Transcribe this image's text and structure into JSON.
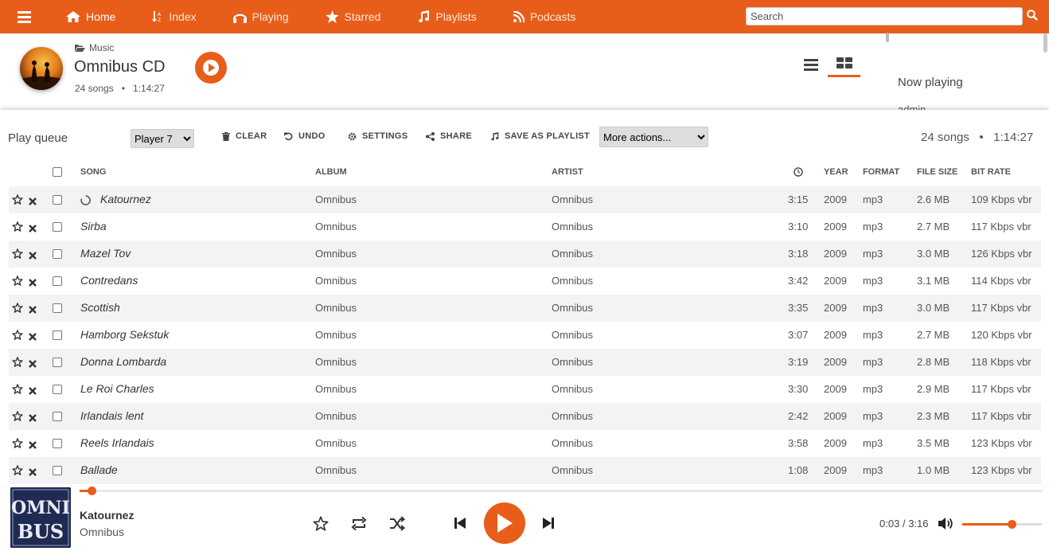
{
  "colors": {
    "accent": "#e85d1a"
  },
  "nav": {
    "items": [
      {
        "label": "Home",
        "icon": "home-icon"
      },
      {
        "label": "Index",
        "icon": "sort-alpha-icon"
      },
      {
        "label": "Playing",
        "icon": "headphones-icon"
      },
      {
        "label": "Starred",
        "icon": "star-icon"
      },
      {
        "label": "Playlists",
        "icon": "music-icon"
      },
      {
        "label": "Podcasts",
        "icon": "rss-icon"
      }
    ],
    "search_placeholder": "Search"
  },
  "album": {
    "breadcrumb": "Music",
    "title": "Omnibus CD",
    "song_count": "24 songs",
    "duration": "1:14:27"
  },
  "sidebar": {
    "now_playing": "Now playing",
    "user": "admin"
  },
  "queue": {
    "title": "Play queue",
    "player": "Player 7",
    "buttons": {
      "clear": "CLEAR",
      "undo": "UNDO",
      "settings": "SETTINGS",
      "share": "SHARE",
      "save": "SAVE AS PLAYLIST"
    },
    "more_actions": "More actions...",
    "summary_count": "24 songs",
    "summary_duration": "1:14:27",
    "headers": {
      "song": "SONG",
      "album": "ALBUM",
      "artist": "ARTIST",
      "year": "YEAR",
      "format": "FORMAT",
      "size": "FILE SIZE",
      "bitrate": "BIT RATE"
    },
    "rows": [
      {
        "song": "Katournez",
        "album": "Omnibus",
        "artist": "Omnibus",
        "duration": "3:15",
        "year": "2009",
        "format": "mp3",
        "size": "2.6 MB",
        "bitrate": "109 Kbps vbr",
        "playing": true
      },
      {
        "song": "Sirba",
        "album": "Omnibus",
        "artist": "Omnibus",
        "duration": "3:10",
        "year": "2009",
        "format": "mp3",
        "size": "2.7 MB",
        "bitrate": "117 Kbps vbr"
      },
      {
        "song": "Mazel Tov",
        "album": "Omnibus",
        "artist": "Omnibus",
        "duration": "3:18",
        "year": "2009",
        "format": "mp3",
        "size": "3.0 MB",
        "bitrate": "126 Kbps vbr"
      },
      {
        "song": "Contredans",
        "album": "Omnibus",
        "artist": "Omnibus",
        "duration": "3:42",
        "year": "2009",
        "format": "mp3",
        "size": "3.1 MB",
        "bitrate": "114 Kbps vbr"
      },
      {
        "song": "Scottish",
        "album": "Omnibus",
        "artist": "Omnibus",
        "duration": "3:35",
        "year": "2009",
        "format": "mp3",
        "size": "3.0 MB",
        "bitrate": "117 Kbps vbr"
      },
      {
        "song": "Hamborg Sekstuk",
        "album": "Omnibus",
        "artist": "Omnibus",
        "duration": "3:07",
        "year": "2009",
        "format": "mp3",
        "size": "2.7 MB",
        "bitrate": "120 Kbps vbr"
      },
      {
        "song": "Donna Lombarda",
        "album": "Omnibus",
        "artist": "Omnibus",
        "duration": "3:19",
        "year": "2009",
        "format": "mp3",
        "size": "2.8 MB",
        "bitrate": "118 Kbps vbr"
      },
      {
        "song": "Le Roi Charles",
        "album": "Omnibus",
        "artist": "Omnibus",
        "duration": "3:30",
        "year": "2009",
        "format": "mp3",
        "size": "2.9 MB",
        "bitrate": "117 Kbps vbr"
      },
      {
        "song": "Irlandais lent",
        "album": "Omnibus",
        "artist": "Omnibus",
        "duration": "2:42",
        "year": "2009",
        "format": "mp3",
        "size": "2.3 MB",
        "bitrate": "117 Kbps vbr"
      },
      {
        "song": "Reels Irlandais",
        "album": "Omnibus",
        "artist": "Omnibus",
        "duration": "3:58",
        "year": "2009",
        "format": "mp3",
        "size": "3.5 MB",
        "bitrate": "123 Kbps vbr"
      },
      {
        "song": "Ballade",
        "album": "Omnibus",
        "artist": "Omnibus",
        "duration": "1:08",
        "year": "2009",
        "format": "mp3",
        "size": "1.0 MB",
        "bitrate": "123 Kbps vbr"
      }
    ]
  },
  "player": {
    "title": "Katournez",
    "artist": "Omnibus",
    "cover_text": "OMNIBUS",
    "elapsed": "0:03",
    "total": "3:16",
    "time_separator": "/",
    "progress_fraction": 0.012,
    "volume_fraction": 0.62
  }
}
